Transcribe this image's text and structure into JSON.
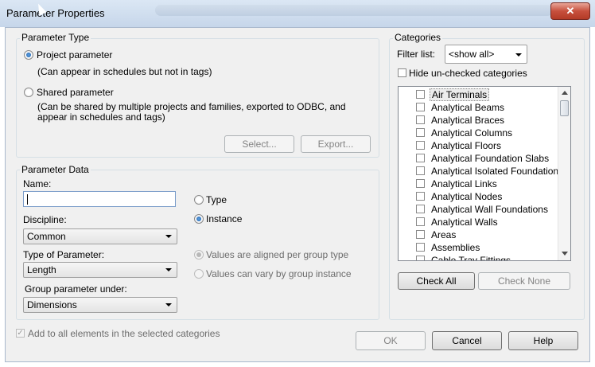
{
  "window": {
    "title": "Parameter Properties",
    "close_glyph": "✕"
  },
  "parameter_type": {
    "group_label": "Parameter Type",
    "project": {
      "label": "Project parameter",
      "desc": "(Can appear in schedules but not in tags)",
      "selected": true
    },
    "shared": {
      "label": "Shared parameter",
      "desc_line1": "(Can be shared by multiple projects and families, exported to ODBC, and",
      "desc_line2": "appear in schedules and tags)",
      "selected": false
    },
    "select_button": "Select...",
    "export_button": "Export..."
  },
  "parameter_data": {
    "group_label": "Parameter Data",
    "name_label": "Name:",
    "name_value": "",
    "discipline_label": "Discipline:",
    "discipline_value": "Common",
    "type_label": "Type of Parameter:",
    "type_value": "Length",
    "group_under_label": "Group parameter under:",
    "group_under_value": "Dimensions",
    "type_radio": {
      "label": "Type",
      "selected": false
    },
    "instance_radio": {
      "label": "Instance",
      "selected": true
    },
    "aligned_radio": {
      "label": "Values are aligned per group type",
      "selected": true
    },
    "vary_radio": {
      "label": "Values can vary by group instance",
      "selected": false
    }
  },
  "categories": {
    "group_label": "Categories",
    "filter_label": "Filter list:",
    "filter_value": "<show all>",
    "hide_unchecked_label": "Hide un-checked categories",
    "items": [
      "Air Terminals",
      "Analytical Beams",
      "Analytical Braces",
      "Analytical Columns",
      "Analytical Floors",
      "Analytical Foundation Slabs",
      "Analytical Isolated Foundations",
      "Analytical Links",
      "Analytical Nodes",
      "Analytical Wall Foundations",
      "Analytical Walls",
      "Areas",
      "Assemblies",
      "Cable Tray Fittings"
    ],
    "check_all": "Check All",
    "check_none": "Check None"
  },
  "footer": {
    "add_to_all_label": "Add to all elements in the selected categories",
    "ok": "OK",
    "cancel": "Cancel",
    "help": "Help"
  }
}
